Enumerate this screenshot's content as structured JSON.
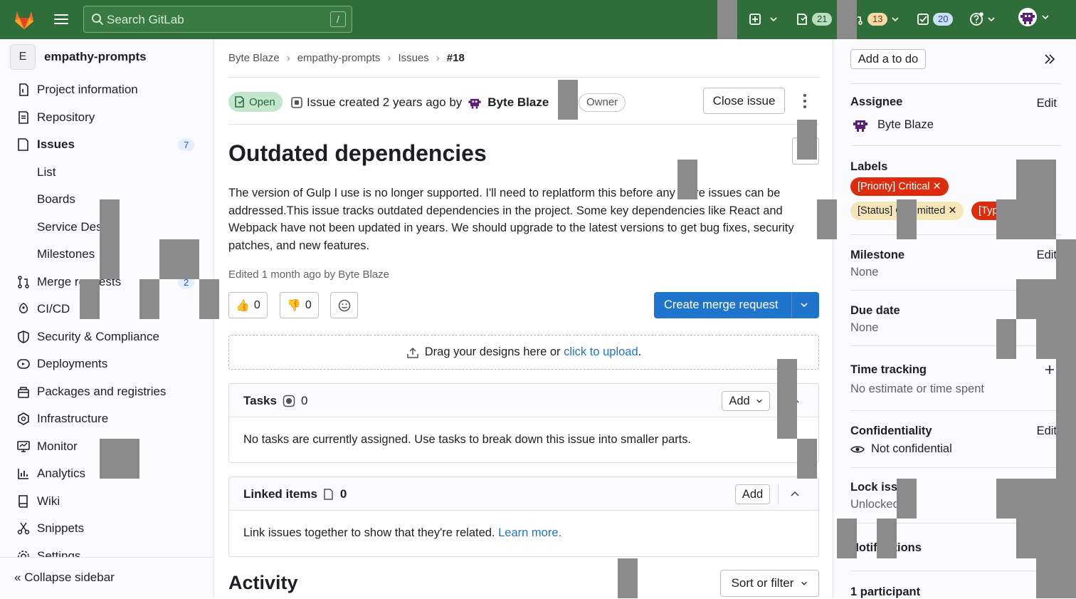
{
  "topbar": {
    "search_placeholder": "Search GitLab",
    "search_shortcut": "/",
    "issues_count": "21",
    "merge_requests_count": "13",
    "todos_count": "20"
  },
  "sidebar": {
    "project_initial": "E",
    "project_name": "empathy-prompts",
    "items": [
      {
        "label": "Project information",
        "icon": "project-info-icon"
      },
      {
        "label": "Repository",
        "icon": "repository-icon"
      },
      {
        "label": "Issues",
        "icon": "issues-icon",
        "count": "7"
      },
      {
        "label": "List"
      },
      {
        "label": "Boards"
      },
      {
        "label": "Service Desk"
      },
      {
        "label": "Milestones"
      },
      {
        "label": "Merge requests",
        "icon": "merge-request-icon",
        "count": "2"
      },
      {
        "label": "CI/CD",
        "icon": "rocket-icon"
      },
      {
        "label": "Security & Compliance",
        "icon": "shield-icon"
      },
      {
        "label": "Deployments",
        "icon": "deployments-icon"
      },
      {
        "label": "Packages and registries",
        "icon": "package-icon"
      },
      {
        "label": "Infrastructure",
        "icon": "cloud-icon"
      },
      {
        "label": "Monitor",
        "icon": "monitor-icon"
      },
      {
        "label": "Analytics",
        "icon": "chart-icon"
      },
      {
        "label": "Wiki",
        "icon": "book-icon"
      },
      {
        "label": "Snippets",
        "icon": "scissors-icon"
      },
      {
        "label": "Settings",
        "icon": "gear-icon"
      }
    ],
    "collapse_label": "Collapse sidebar"
  },
  "breadcrumb": [
    "Byte Blaze",
    "empathy-prompts",
    "Issues",
    "#18"
  ],
  "issue": {
    "status": "Open",
    "created_text": "Issue created 2 years ago by",
    "author": "Byte Blaze",
    "author_role": "Owner",
    "close_button": "Close issue",
    "title": "Outdated dependencies",
    "description": "The version of Gulp I use is no longer supported. I'll need to replatform this before any more issues can be addressed.This issue tracks outdated dependencies in the project. Some key dependencies like React and Webpack have not been updated in years. We should upgrade to the latest versions to get bug fixes, security patches, and new features.",
    "edited": "Edited 1 month ago by Byte Blaze",
    "thumbs_up": "0",
    "thumbs_down": "0",
    "create_mr": "Create merge request",
    "upload_text": "Drag your designs here or",
    "upload_link": "click to upload",
    "upload_tail": "."
  },
  "tasks": {
    "title": "Tasks",
    "count": "0",
    "add": "Add",
    "empty": "No tasks are currently assigned. Use tasks to break down this issue into smaller parts."
  },
  "linked": {
    "title": "Linked items",
    "count": "0",
    "add": "Add",
    "text": "Link issues together to show that they're related.",
    "link": "Learn more."
  },
  "activity": {
    "title": "Activity",
    "sort": "Sort or filter"
  },
  "rightbar": {
    "todo": "Add a to do",
    "assignee_h": "Assignee",
    "assignee": "Byte Blaze",
    "edit": "Edit",
    "labels_h": "Labels",
    "labels": [
      {
        "text": "[Priority] Critical",
        "bg": "#dd2b0e",
        "fg": "#ffffff"
      },
      {
        "text": "[Status] Committed",
        "bg": "#f5e6b8",
        "fg": "#1f1e24"
      },
      {
        "text": "[Type] Bug",
        "bg": "#dd2b0e",
        "fg": "#ffffff"
      }
    ],
    "milestone_h": "Milestone",
    "milestone": "None",
    "due_h": "Due date",
    "due": "None",
    "time_h": "Time tracking",
    "time": "No estimate or time spent",
    "conf_h": "Confidentiality",
    "conf": "Not confidential",
    "lock_h": "Lock issue",
    "lock": "Unlocked",
    "notif_h": "Notifications",
    "participants": "1 participant"
  }
}
